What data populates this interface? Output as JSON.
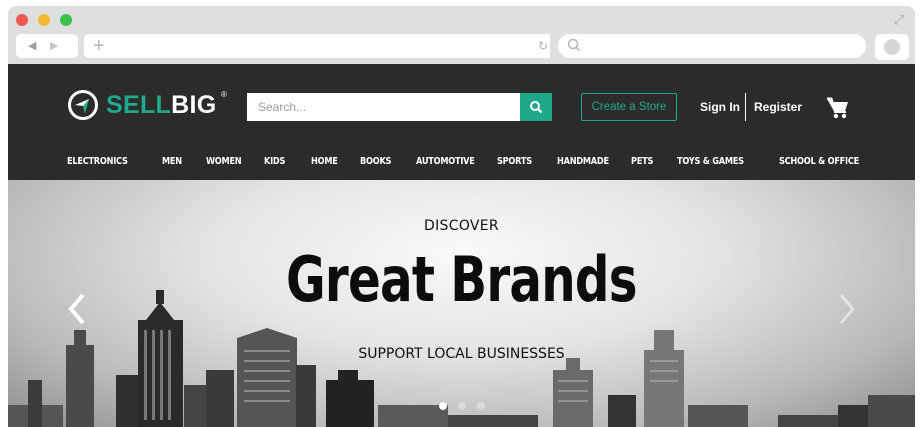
{
  "browser": {
    "back_icon": "back-arrow-icon",
    "forward_icon": "forward-arrow-icon",
    "new_tab_icon": "plus-icon",
    "reload_icon": "reload-icon",
    "search_icon": "search-icon",
    "window_controls": [
      "close",
      "minimize",
      "zoom"
    ]
  },
  "site": {
    "logo": {
      "part1": "SELL",
      "part2": "BIG",
      "reg": "®"
    },
    "search": {
      "placeholder": "Search..."
    },
    "create_store_label": "Create a Store",
    "signin_label": "Sign In",
    "register_label": "Register",
    "menu": [
      "ELECTRONICS",
      "MEN",
      "WOMEN",
      "KIDS",
      "HOME",
      "BOOKS",
      "AUTOMOTIVE",
      "SPORTS",
      "HANDMADE",
      "PETS",
      "TOYS & GAMES",
      "SCHOOL & OFFICE"
    ],
    "colors": {
      "accent": "#1fa88c",
      "header_bg": "#2b2b2b"
    }
  },
  "hero": {
    "kicker": "DISCOVER",
    "headline": "Great Brands",
    "subline": "SUPPORT LOCAL BUSINESSES",
    "slide_count": 3,
    "active_slide": 1
  }
}
